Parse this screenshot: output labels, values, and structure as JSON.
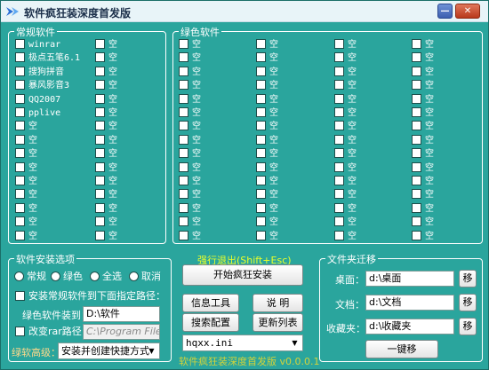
{
  "window": {
    "title": "软件疯狂装深度首发版",
    "minimize_glyph": "—",
    "close_glyph": "✕"
  },
  "common": {
    "legend": "常规软件",
    "col1": [
      "winrar",
      "极点五笔6.1",
      "搜狗拼音",
      "暴风影音3",
      "QQ2007",
      "pplive",
      "空",
      "空",
      "空",
      "空",
      "空",
      "空",
      "空",
      "空",
      "空"
    ],
    "col2": [
      "空",
      "空",
      "空",
      "空",
      "空",
      "空",
      "空",
      "空",
      "空",
      "空",
      "空",
      "空",
      "空",
      "空",
      "空"
    ]
  },
  "green": {
    "legend": "绿色软件",
    "cols": [
      [
        "空",
        "空",
        "空",
        "空",
        "空",
        "空",
        "空",
        "空",
        "空",
        "空",
        "空",
        "空",
        "空",
        "空",
        "空"
      ],
      [
        "空",
        "空",
        "空",
        "空",
        "空",
        "空",
        "空",
        "空",
        "空",
        "空",
        "空",
        "空",
        "空",
        "空",
        "空"
      ],
      [
        "空",
        "空",
        "空",
        "空",
        "空",
        "空",
        "空",
        "空",
        "空",
        "空",
        "空",
        "空",
        "空",
        "空",
        "空"
      ],
      [
        "空",
        "空",
        "空",
        "空",
        "空",
        "空",
        "空",
        "空",
        "空",
        "空",
        "空",
        "空",
        "空",
        "空",
        "空"
      ]
    ]
  },
  "install": {
    "legend": "软件安装选项",
    "radios": [
      "常规",
      "绿色",
      "全选",
      "取消"
    ],
    "selected_radio": "",
    "path_checkbox_label": "安装常规软件到下面指定路径：",
    "green_to_label": "绿色软件装到：",
    "green_to_value": "D:\\软件",
    "rar_checkbox_label": "改变rar路径：",
    "rar_path_value": "C:\\Program Files",
    "advanced_label": "绿软高级：",
    "advanced_select": "安装并创建快捷方式"
  },
  "middle": {
    "exit_link": "强行退出(Shift+Esc)",
    "start_button": "开始疯狂安装",
    "info_button": "信息工具",
    "help_button": "说 明",
    "search_button": "搜索配置",
    "refresh_button": "更新列表",
    "config_select": "hqxx.ini"
  },
  "migrate": {
    "legend": "文件夹迁移",
    "rows": [
      {
        "label": "桌面：",
        "value": "d:\\桌面",
        "button": "移"
      },
      {
        "label": "文档：",
        "value": "d:\\文档",
        "button": "移"
      },
      {
        "label": "收藏夹：",
        "value": "d:\\收藏夹",
        "button": "移"
      }
    ],
    "one_key_button": "一键移"
  },
  "footer": {
    "text": "软件疯狂装深度首发版 v0.0.0.1"
  }
}
